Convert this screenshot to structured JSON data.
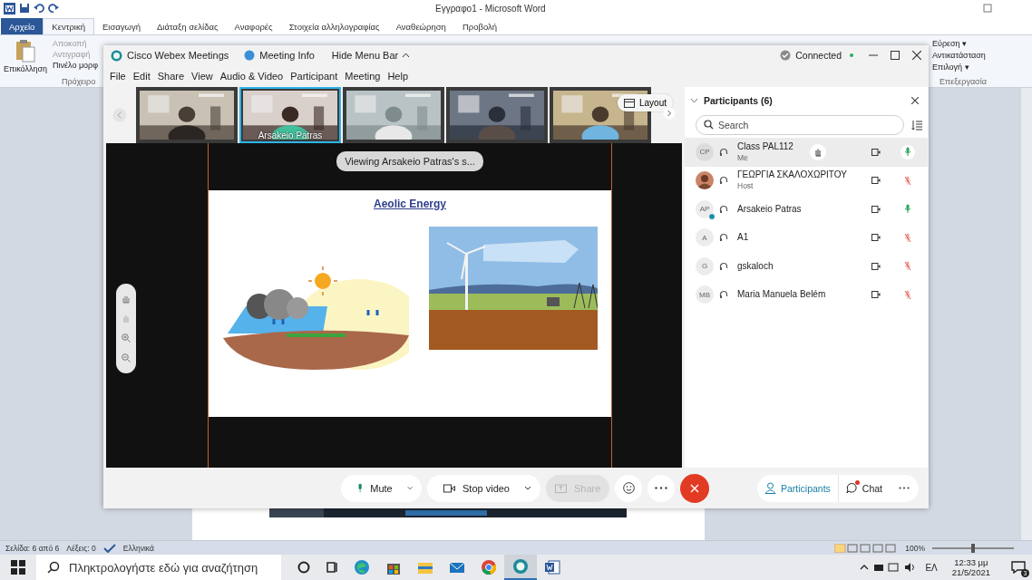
{
  "word": {
    "title": "Εγγραφο1 - Microsoft Word",
    "tabs": [
      {
        "label": "Αρχείο",
        "kind": "file",
        "selected": false
      },
      {
        "label": "Κεντρική",
        "kind": "tab",
        "selected": true
      },
      {
        "label": "Εισαγωγή",
        "kind": "tab",
        "selected": false
      },
      {
        "label": "Διάταξη σελίδας",
        "kind": "tab",
        "selected": false
      },
      {
        "label": "Αναφορές",
        "kind": "tab",
        "selected": false
      },
      {
        "label": "Στοιχεία αλληλογραφίας",
        "kind": "tab",
        "selected": false
      },
      {
        "label": "Αναθεώρηση",
        "kind": "tab",
        "selected": false
      },
      {
        "label": "Προβολή",
        "kind": "tab",
        "selected": false
      }
    ],
    "clipboard": {
      "paste": "Επικόλληση",
      "items": [
        "Αποκοπή",
        "Αντιγραφή",
        "Πινέλο μορφ"
      ],
      "group": "Πρόχειρο"
    },
    "editing": {
      "items": [
        "Εύρεση ▾",
        "Αντικατάσταση",
        "Επιλογή ▾"
      ],
      "group": "Επεξεργασία"
    },
    "status_bar": {
      "page": "Σελίδα: 6 από 6",
      "words": "Λέξεις: 0",
      "language": "Ελληνικά",
      "zoom": "100%",
      "zoom_level": {
        "level": 0.5
      }
    }
  },
  "webex": {
    "app_name": "Cisco Webex Meetings",
    "meeting_info": "Meeting Info",
    "hide_menu": "Hide Menu Bar",
    "status": "Connected",
    "connected": true,
    "menu": [
      "File",
      "Edit",
      "Share",
      "View",
      "Audio & Video",
      "Participant",
      "Meeting",
      "Help"
    ],
    "thumbnails": [
      {
        "kind": "picture",
        "selected": false
      },
      {
        "kind": "picture",
        "selected": true,
        "label": "Arsakeio Patras"
      },
      {
        "kind": "picture",
        "selected": false
      },
      {
        "kind": "picture",
        "selected": false
      },
      {
        "kind": "picture",
        "selected": false
      }
    ],
    "layout_button": "Layout",
    "share_banner": "Viewing Arsakeio Patras's s...",
    "slide": {
      "title": "Aeolic Energy"
    },
    "participants": {
      "title": "Participants (6)",
      "search_placeholder": "Search",
      "rows": [
        {
          "kind": "initials",
          "initials": "CP",
          "name": "Class PAL112",
          "role": "Me",
          "muted": false,
          "selected": true
        },
        {
          "name": "ΓΕΩΡΓΙΑ ΣΚΑΛΟΧΩΡΙΤΟΥ",
          "role": "Host",
          "muted": true,
          "selected": false
        },
        {
          "kind": "initials",
          "initials": "AP",
          "name": "Arsakeio Patras",
          "presenter": true,
          "muted": false,
          "selected": false
        },
        {
          "kind": "initials",
          "initials": "A",
          "name": "A1",
          "muted": true,
          "selected": false
        },
        {
          "kind": "initials",
          "initials": "G",
          "name": "gskaloch",
          "muted": true,
          "selected": false
        },
        {
          "kind": "initials",
          "initials": "MB",
          "name": "Maria Manuela Belém",
          "muted": true,
          "selected": false
        }
      ]
    },
    "controls": {
      "mute": "Mute",
      "video": "Stop video",
      "share": "Share",
      "share_disabled": true
    },
    "side_buttons": [
      {
        "kind": "participants",
        "label": "Participants",
        "selected": true,
        "unread": false
      },
      {
        "kind": "chat",
        "label": "Chat",
        "selected": false,
        "unread": true
      }
    ]
  },
  "taskbar": {
    "search_placeholder": "Πληκτρολογήστε εδώ για αναζήτηση",
    "language": "ΕΛ",
    "time": "12:33 μμ",
    "date": "21/5/2021",
    "notifications": "3"
  }
}
